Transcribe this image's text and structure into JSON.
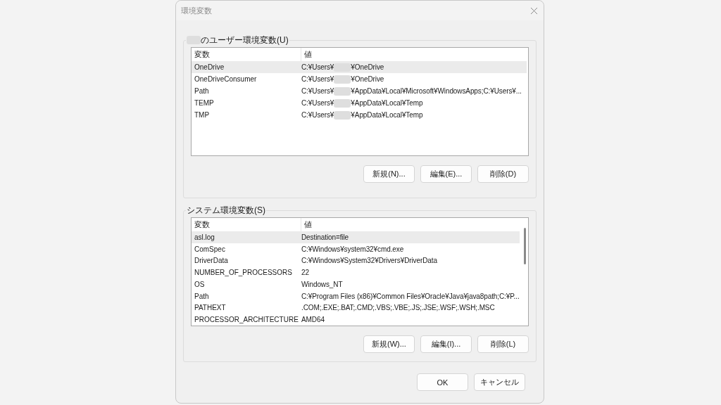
{
  "window": {
    "title": "環境変数"
  },
  "user_section": {
    "label_redacted": true,
    "label": "のユーザー環境変数(U)",
    "columns": [
      "変数",
      "値"
    ],
    "rows": [
      {
        "name": "OneDrive",
        "value": "C:¥Users¥",
        "redacted": true,
        "value_rest": "¥OneDrive",
        "selected": true
      },
      {
        "name": "OneDriveConsumer",
        "value": "C:¥Users¥",
        "redacted": true,
        "value_rest": "¥OneDrive",
        "selected": false
      },
      {
        "name": "Path",
        "value": "C:¥Users¥",
        "redacted": true,
        "value_rest": "¥AppData¥Local¥Microsoft¥WindowsApps;C:¥Users¥...",
        "selected": false
      },
      {
        "name": "TEMP",
        "value": "C:¥Users¥",
        "redacted": true,
        "value_rest": "¥AppData¥Local¥Temp",
        "selected": false
      },
      {
        "name": "TMP",
        "value": "C:¥Users¥",
        "redacted": true,
        "value_rest": "¥AppData¥Local¥Temp",
        "selected": false
      }
    ],
    "buttons": [
      "新規(N)...",
      "編集(E)...",
      "削除(D)"
    ]
  },
  "system_section": {
    "label": "システム環境変数(S)",
    "columns": [
      "変数",
      "値"
    ],
    "rows": [
      {
        "name": "asl.log",
        "value": "Destination=file",
        "redacted": false,
        "selected": true
      },
      {
        "name": "ComSpec",
        "value": "C:¥Windows¥system32¥cmd.exe",
        "redacted": false,
        "selected": false
      },
      {
        "name": "DriverData",
        "value": "C:¥Windows¥System32¥Drivers¥DriverData",
        "redacted": false,
        "selected": false
      },
      {
        "name": "NUMBER_OF_PROCESSORS",
        "value": "22",
        "redacted": false,
        "selected": false
      },
      {
        "name": "OS",
        "value": "Windows_NT",
        "redacted": false,
        "selected": false
      },
      {
        "name": "Path",
        "value": "C:¥Program Files (x86)¥Common Files¥Oracle¥Java¥java8path;C:¥P...",
        "redacted": false,
        "selected": false
      },
      {
        "name": "PATHEXT",
        "value": ".COM;.EXE;.BAT;.CMD;.VBS;.VBE;.JS;.JSE;.WSF;.WSH;.MSC",
        "redacted": false,
        "selected": false
      },
      {
        "name": "PROCESSOR_ARCHITECTURE",
        "value": "AMD64",
        "redacted": false,
        "selected": false
      }
    ],
    "buttons": [
      "新規(W)...",
      "編集(I)...",
      "削除(L)"
    ]
  },
  "footer_buttons": [
    "OK",
    "キャンセル"
  ]
}
